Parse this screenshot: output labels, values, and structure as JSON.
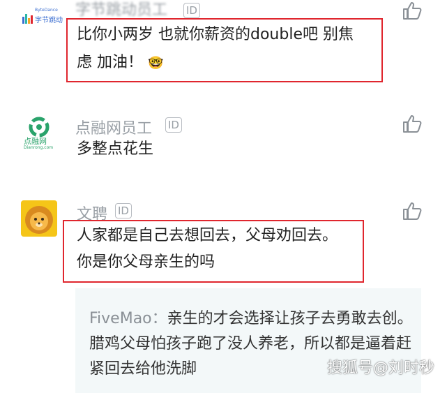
{
  "comments": [
    {
      "name": "字节跳动员工",
      "badge": "ID",
      "avatar_logo": "字节跳动",
      "avatar_logo_small": "ByteDance",
      "lines": [
        "比你小两岁 也就你薪资的double吧 别焦",
        "虑 加油！"
      ],
      "emoji": "🤓",
      "highlighted": true
    },
    {
      "name": "点融网员工",
      "badge": "ID",
      "avatar_logo": "点融网",
      "avatar_logo_small": "Dianrong.com",
      "lines": [
        "多整点花生"
      ],
      "highlighted": false
    },
    {
      "name": "文聘",
      "badge": "ID",
      "avatar_logo": "lion-avatar",
      "lines": [
        "人家都是自己去想回去，父母劝回去。",
        "你是你父母亲生的吗"
      ],
      "highlighted": true
    }
  ],
  "reply": {
    "author": "FiveMao",
    "separator": "：",
    "text": "亲生的才会选择让孩子去勇敢去创。腊鸡父母怕孩子跑了没人养老，所以都是逼着赶紧回去给他洗脚"
  },
  "watermark": "搜狐号@刘时秒",
  "colors": {
    "highlight_border": "#e0262e",
    "name_gray": "#9aa0a6",
    "reply_bg": "#f3f8f9",
    "dianrong_green": "#2aa36b",
    "lion_bg": "#f5c518"
  },
  "icons": [
    "like-icon",
    "id-badge-icon"
  ]
}
